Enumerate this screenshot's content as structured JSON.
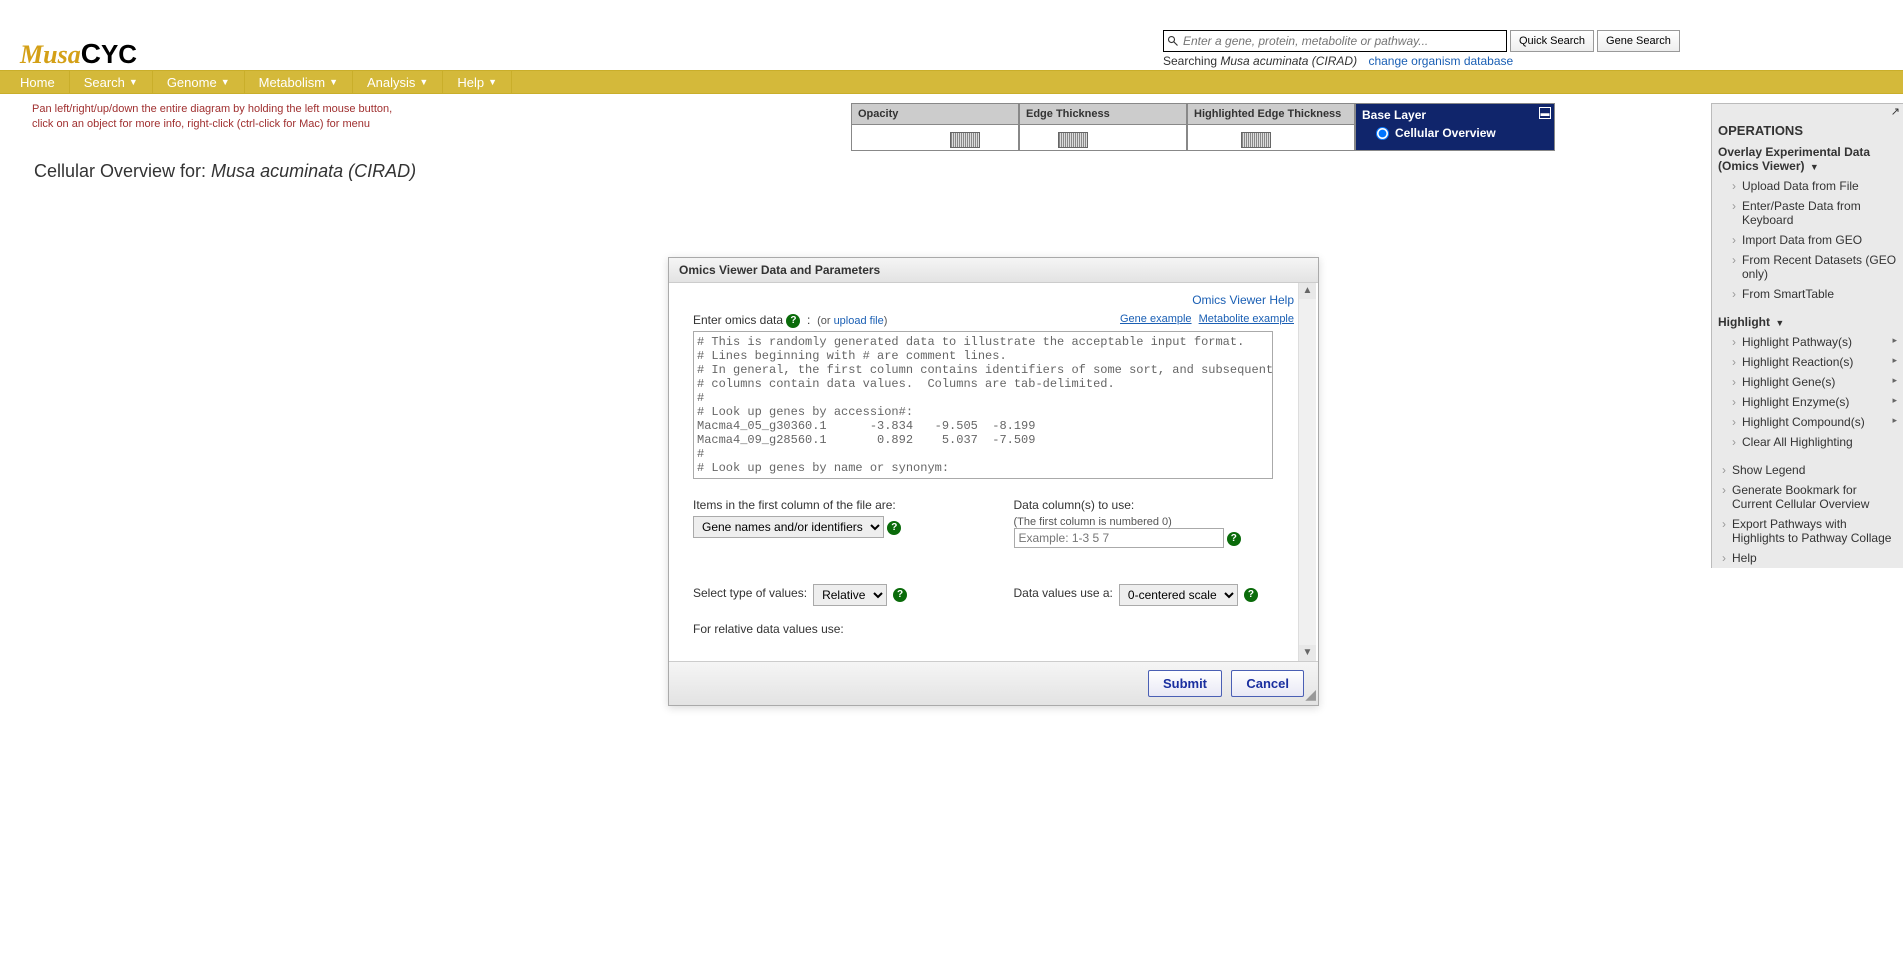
{
  "logo": {
    "part1": "Musa",
    "part2_c": "C",
    "part2_yc": "YC"
  },
  "search": {
    "placeholder": "Enter a gene, protein, metabolite or pathway...",
    "quick_btn": "Quick Search",
    "gene_btn": "Gene Search",
    "searching_label": "Searching ",
    "organism": "Musa acuminata (CIRAD)",
    "change_link": "change organism database"
  },
  "nav": [
    {
      "label": "Home",
      "has_caret": false
    },
    {
      "label": "Search",
      "has_caret": true
    },
    {
      "label": "Genome",
      "has_caret": true
    },
    {
      "label": "Metabolism",
      "has_caret": true
    },
    {
      "label": "Analysis",
      "has_caret": true
    },
    {
      "label": "Help",
      "has_caret": true
    }
  ],
  "hint": {
    "line1": "Pan left/right/up/down the entire diagram by holding the left mouse button,",
    "line2": "click on an object for more info, right-click (ctrl-click for Mac) for menu"
  },
  "controls": {
    "opacity": "Opacity",
    "edge": "Edge Thickness",
    "hedge": "Highlighted Edge Thickness",
    "base_layer_title": "Base Layer",
    "base_layer_opt": "Cellular Overview"
  },
  "page_title": {
    "prefix": "Cellular Overview for: ",
    "organism": "Musa acuminata (CIRAD)"
  },
  "ops": {
    "header": "OPERATIONS",
    "overlay": {
      "line1": "Overlay Experimental Data",
      "line2": "(Omics Viewer)"
    },
    "overlay_items": [
      "Upload Data from File",
      "Enter/Paste Data from Keyboard",
      "Import Data from GEO",
      "From Recent Datasets (GEO only)",
      "From SmartTable"
    ],
    "highlight_header": "Highlight",
    "highlight_items": [
      "Highlight Pathway(s)",
      "Highlight Reaction(s)",
      "Highlight Gene(s)",
      "Highlight Enzyme(s)",
      "Highlight Compound(s)"
    ],
    "clear": "Clear All Highlighting",
    "bottom_items": [
      "Show Legend",
      "Generate Bookmark for Current Cellular Overview",
      "Export Pathways with Highlights to Pathway Collage",
      "Help"
    ]
  },
  "dialog": {
    "title": "Omics Viewer Data and Parameters",
    "help_link": "Omics Viewer Help",
    "enter_label": "Enter omics data",
    "or": "(or ",
    "upload": "upload file",
    "close_paren": ")",
    "gene_ex": "Gene example",
    "metab_ex": "Metabolite example",
    "textarea": "# This is randomly generated data to illustrate the acceptable input format.\n# Lines beginning with # are comment lines.\n# In general, the first column contains identifiers of some sort, and subsequent\n# columns contain data values.  Columns are tab-delimited.\n#\n# Look up genes by accession#:\nMacma4_05_g30360.1      -3.834   -9.505  -8.199\nMacma4_09_g28560.1       0.892    5.037  -7.509\n#\n# Look up genes by name or synonym:",
    "items_label": "Items in the first column of the file are:",
    "items_select": "Gene names and/or identifiers",
    "cols_label": "Data column(s) to use:",
    "cols_note": "(The first column is numbered 0)",
    "cols_placeholder": "Example: 1-3 5 7",
    "type_label": "Select type of values:",
    "type_select": "Relative",
    "scale_label": "Data values use a:",
    "scale_select": "0-centered scale",
    "relative_label": "For relative data values use:",
    "submit": "Submit",
    "cancel": "Cancel"
  }
}
